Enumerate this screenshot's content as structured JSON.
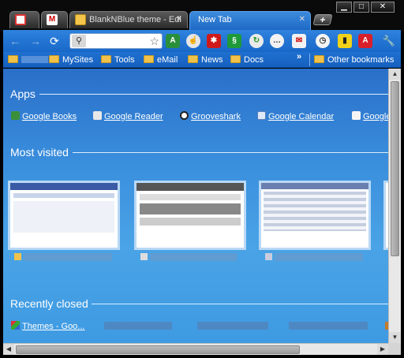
{
  "window_controls": {
    "minimize": "▁",
    "maximize": "□",
    "close": "✕"
  },
  "tabs": [
    {
      "title": "",
      "icon": "page-icon"
    },
    {
      "title": "",
      "icon": "gmail-icon"
    },
    {
      "title": "BlankNBlue theme - Edi",
      "icon": "theme-gallery-icon"
    },
    {
      "title": "New Tab",
      "icon": "",
      "active": true
    }
  ],
  "new_tab_label": "+",
  "toolbar": {
    "omnibox_value": "",
    "extensions": [
      "translate-icon",
      "cursor-icon",
      "red-star-icon",
      "stumble-icon",
      "refresh-green-icon",
      "chat-icon",
      "mail-checker-icon",
      "clock-icon",
      "phone-icon",
      "pdf-icon",
      "wrench-icon"
    ]
  },
  "bookmarks": {
    "items": [
      "",
      "MySites",
      "Tools",
      "eMail",
      "News",
      "Docs"
    ],
    "overflow": "»",
    "other": "Other bookmarks"
  },
  "apps": {
    "heading": "Apps",
    "items": [
      "Google Books",
      "Google Reader",
      "Grooveshark",
      "Google Calendar",
      "Google"
    ]
  },
  "most_visited": {
    "heading": "Most visited"
  },
  "recently_closed": {
    "heading": "Recently closed",
    "first_item": "Themes - Goo..."
  },
  "colors": {
    "content_top": "#2a6fc9",
    "content_bottom": "#3e9ae2",
    "active_tab": "#3d8bdc"
  }
}
